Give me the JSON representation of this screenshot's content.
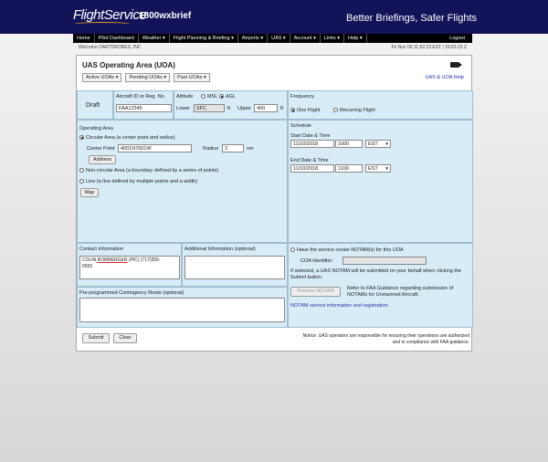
{
  "header": {
    "logo": "FlightService",
    "phone": "1800wxbrief",
    "slogan": "Better Briefings, Safer Flights"
  },
  "nav": {
    "items": [
      "Home",
      "Pilot Dashboard",
      "Weather ▾",
      "Flight Planning & Briefing ▾",
      "Airports ▾",
      "UAS ▾",
      "Account ▾",
      "Links ▾",
      "Help ▾"
    ],
    "logout": "Logout"
  },
  "subbar": {
    "welcome": "Welcome DARTDRONES, INC",
    "clock": "Fri Nov 09 11:52:23 EST | 16:52:23 Z"
  },
  "page": {
    "title": "UAS Operating Area (UOA)",
    "help_link": "UAS & UOA Help",
    "dropdowns": [
      "Active UOAs ▾",
      "Pending UOAs ▾",
      "Past UOAs ▾"
    ]
  },
  "status": {
    "label": "Draft"
  },
  "aircraft": {
    "label": "Aircraft ID or Reg. No.",
    "value": "FAA12345"
  },
  "altitude": {
    "label": "Altitude",
    "msl": "MSL",
    "agl": "AGL",
    "lower_label": "Lower",
    "lower_value": "SFC",
    "lower_unit": "ft",
    "upper_label": "Upper",
    "upper_value": "400",
    "upper_unit": "ft"
  },
  "frequency": {
    "label": "Frequency",
    "one": "One Flight",
    "recurring": "Recurring Flight"
  },
  "operating_area": {
    "label": "Operating Area",
    "circular": "Circular Area (a center point and radius)",
    "center_label": "Center Point",
    "center_value": "4001N7601W",
    "radius_label": "Radius",
    "radius_value": "3",
    "radius_unit": "nm",
    "address_button": "Address",
    "noncircular": "Non-circular Area (a boundary defined by a series of points)",
    "line": "Line (a line defined by multiple points and a width)",
    "map_button": "Map"
  },
  "schedule": {
    "label": "Schedule",
    "start_label": "Start Date & Time",
    "start_date": "11/10/2018",
    "start_time": "1000",
    "start_tz": "EST",
    "end_label": "End Date & Time",
    "end_date": "11/10/2018",
    "end_time": "1100",
    "end_tz": "EST"
  },
  "contact": {
    "label": "Contact Information",
    "line1_pre": "COLIN ",
    "line1_name": "ROMBERGER",
    "line1_post": " (PIC) (717)555-",
    "line2": "5555"
  },
  "additional": {
    "label": "Additional Information (optional)"
  },
  "contingency": {
    "label": "Pre-programmed Contingency Route (optional)"
  },
  "notam": {
    "checkbox_label": "Have the service create NOTAM(s) for this UOA",
    "coa_label": "COA Identifier:",
    "info": "If selected, a UAS NOTAM will be submitted on your behalf when clicking the Submit button.",
    "preview_button": "Preview NOTAM",
    "refer_text": "Refer to FAA Guidance regarding submission of NOTAMs for Unmanned Aircraft.",
    "link": "NOTAM service information and registration."
  },
  "footer": {
    "submit": "Submit",
    "clear": "Clear",
    "notice_line1": "Notice: UAS operators are responsible for ensuring their operations are authorized",
    "notice_line2": "and in compliance with FAA guidance."
  }
}
